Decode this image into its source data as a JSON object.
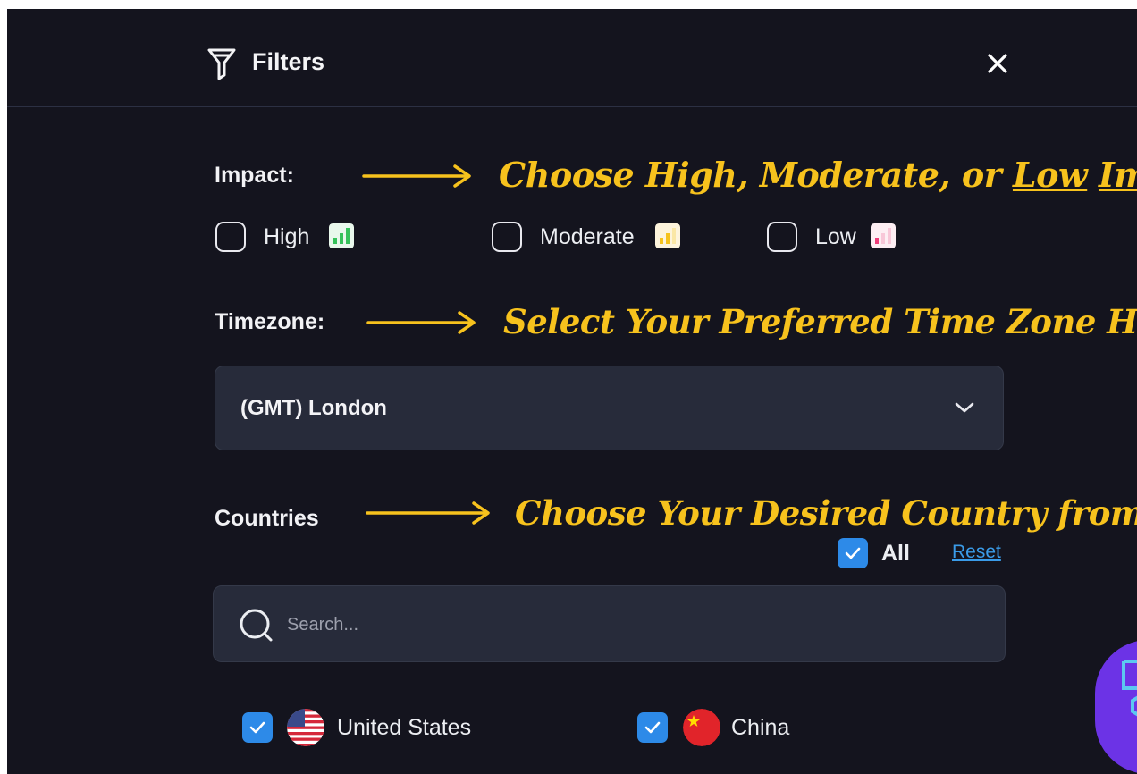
{
  "header": {
    "title": "Filters",
    "icons": {
      "filter": "filter-icon",
      "close": "close-icon"
    }
  },
  "impact": {
    "label": "Impact:",
    "annotation_parts": [
      "Choose High, Moderate, or ",
      "Low",
      " ",
      "Impact"
    ],
    "options": [
      {
        "label": "High",
        "checked": false,
        "bar_color": "#36c25a"
      },
      {
        "label": "Moderate",
        "checked": false,
        "bar_color": "#f6c31d"
      },
      {
        "label": "Low",
        "checked": false,
        "bar_color": "#ef3d7a"
      }
    ]
  },
  "timezone": {
    "label": "Timezone:",
    "annotation": "Select Your Preferred Time Zone Here",
    "selected": "(GMT) London"
  },
  "countries": {
    "label": "Countries",
    "annotation": "Choose Your Desired Country from Here",
    "all_label": "All",
    "all_checked": true,
    "reset_label": "Reset",
    "search_placeholder": "Search...",
    "items": [
      {
        "name": "United States",
        "checked": true,
        "flag": "us-flag-icon"
      },
      {
        "name": "China",
        "checked": true,
        "flag": "china-flag-icon"
      }
    ]
  },
  "colors": {
    "panel_bg": "#14141e",
    "input_bg": "#272b3a",
    "annotation": "#f7c21d",
    "checkbox_blue": "#2d8ae8",
    "link": "#3a9be8",
    "fab": "#6c33e6"
  }
}
